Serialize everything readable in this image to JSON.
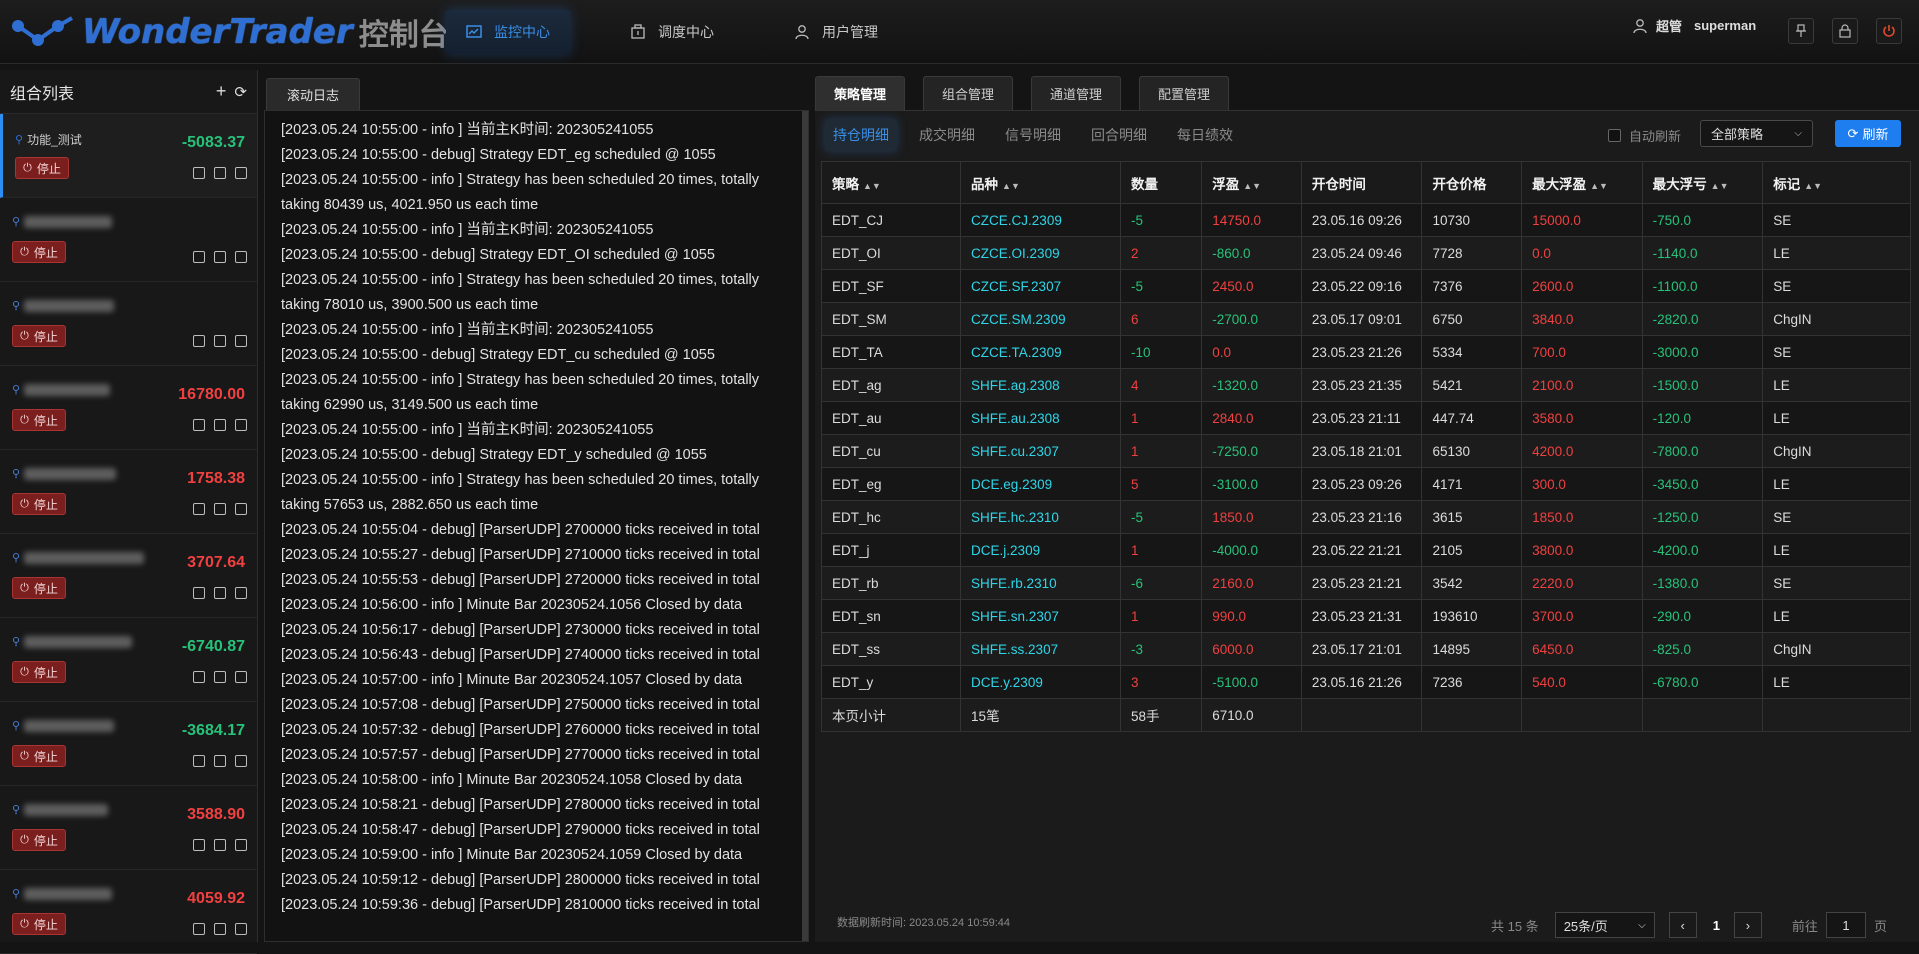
{
  "header": {
    "logo_text": "WonderTrader",
    "logo_sub": "控制台",
    "nav": [
      {
        "label": "监控中心",
        "icon": "monitor-icon"
      },
      {
        "label": "调度中心",
        "icon": "schedule-icon"
      },
      {
        "label": "用户管理",
        "icon": "user-icon"
      }
    ],
    "user_role": "超管",
    "user_name": "superman"
  },
  "left": {
    "title": "组合列表",
    "stop_label": "停止",
    "groups": [
      {
        "name": "功能_测试",
        "value": "-5083.37",
        "color": "green"
      },
      {
        "name": "",
        "value": "",
        "color": "green"
      },
      {
        "name": "",
        "value": "",
        "color": "green"
      },
      {
        "name": "",
        "value": "16780.00",
        "color": "red"
      },
      {
        "name": "",
        "value": "1758.38",
        "color": "red"
      },
      {
        "name": "",
        "value": "3707.64",
        "color": "red"
      },
      {
        "name": "",
        "value": "-6740.87",
        "color": "green"
      },
      {
        "name": "",
        "value": "-3684.17",
        "color": "green"
      },
      {
        "name": "",
        "value": "3588.90",
        "color": "red"
      },
      {
        "name": "",
        "value": "4059.92",
        "color": "red"
      }
    ]
  },
  "log": {
    "tab": "滚动日志",
    "lines": [
      "[2023.05.24 10:55:00 - info ] 当前主K时间: 202305241055",
      "[2023.05.24 10:55:00 - debug] Strategy EDT_eg scheduled @ 1055",
      "[2023.05.24 10:55:00 - info ] Strategy has been scheduled 20 times, totally",
      "taking 80439 us, 4021.950 us each time",
      "[2023.05.24 10:55:00 - info ] 当前主K时间: 202305241055",
      "[2023.05.24 10:55:00 - debug] Strategy EDT_OI scheduled @ 1055",
      "[2023.05.24 10:55:00 - info ] Strategy has been scheduled 20 times, totally",
      "taking 78010 us, 3900.500 us each time",
      "[2023.05.24 10:55:00 - info ] 当前主K时间: 202305241055",
      "[2023.05.24 10:55:00 - debug] Strategy EDT_cu scheduled @ 1055",
      "[2023.05.24 10:55:00 - info ] Strategy has been scheduled 20 times, totally",
      "taking 62990 us, 3149.500 us each time",
      "[2023.05.24 10:55:00 - info ] 当前主K时间: 202305241055",
      "[2023.05.24 10:55:00 - debug] Strategy EDT_y scheduled @ 1055",
      "[2023.05.24 10:55:00 - info ] Strategy has been scheduled 20 times, totally",
      "taking 57653 us, 2882.650 us each time",
      "[2023.05.24 10:55:04 - debug] [ParserUDP] 2700000 ticks received in total",
      "[2023.05.24 10:55:27 - debug] [ParserUDP] 2710000 ticks received in total",
      "[2023.05.24 10:55:53 - debug] [ParserUDP] 2720000 ticks received in total",
      "[2023.05.24 10:56:00 - info ] Minute Bar 20230524.1056 Closed by data",
      "[2023.05.24 10:56:17 - debug] [ParserUDP] 2730000 ticks received in total",
      "[2023.05.24 10:56:43 - debug] [ParserUDP] 2740000 ticks received in total",
      "[2023.05.24 10:57:00 - info ] Minute Bar 20230524.1057 Closed by data",
      "[2023.05.24 10:57:08 - debug] [ParserUDP] 2750000 ticks received in total",
      "[2023.05.24 10:57:32 - debug] [ParserUDP] 2760000 ticks received in total",
      "[2023.05.24 10:57:57 - debug] [ParserUDP] 2770000 ticks received in total",
      "[2023.05.24 10:58:00 - info ] Minute Bar 20230524.1058 Closed by data",
      "[2023.05.24 10:58:21 - debug] [ParserUDP] 2780000 ticks received in total",
      "[2023.05.24 10:58:47 - debug] [ParserUDP] 2790000 ticks received in total",
      "[2023.05.24 10:59:00 - info ] Minute Bar 20230524.1059 Closed by data",
      "[2023.05.24 10:59:12 - debug] [ParserUDP] 2800000 ticks received in total",
      "[2023.05.24 10:59:36 - debug] [ParserUDP] 2810000 ticks received in total"
    ]
  },
  "right": {
    "tabs": [
      "策略管理",
      "组合管理",
      "通道管理",
      "配置管理"
    ],
    "subtabs": [
      "持仓明细",
      "成交明细",
      "信号明细",
      "回合明细",
      "每日绩效"
    ],
    "auto_refresh": "自动刷新",
    "strategy_select": "全部策略",
    "refresh_btn": "刷新",
    "columns": [
      "策略",
      "品种",
      "数量",
      "浮盈",
      "开仓时间",
      "开仓价格",
      "最大浮盈",
      "最大浮亏",
      "标记"
    ],
    "rows": [
      [
        "EDT_CJ",
        "CZCE.CJ.2309",
        "-5",
        "14750.0",
        "23.05.16 09:26",
        "10730",
        "15000.0",
        "-750.0",
        "SE"
      ],
      [
        "EDT_OI",
        "CZCE.OI.2309",
        "2",
        "-860.0",
        "23.05.24 09:46",
        "7728",
        "0.0",
        "-1140.0",
        "LE"
      ],
      [
        "EDT_SF",
        "CZCE.SF.2307",
        "-5",
        "2450.0",
        "23.05.22 09:16",
        "7376",
        "2600.0",
        "-1100.0",
        "SE"
      ],
      [
        "EDT_SM",
        "CZCE.SM.2309",
        "6",
        "-2700.0",
        "23.05.17 09:01",
        "6750",
        "3840.0",
        "-2820.0",
        "ChgIN"
      ],
      [
        "EDT_TA",
        "CZCE.TA.2309",
        "-10",
        "0.0",
        "23.05.23 21:26",
        "5334",
        "700.0",
        "-3000.0",
        "SE"
      ],
      [
        "EDT_ag",
        "SHFE.ag.2308",
        "4",
        "-1320.0",
        "23.05.23 21:35",
        "5421",
        "2100.0",
        "-1500.0",
        "LE"
      ],
      [
        "EDT_au",
        "SHFE.au.2308",
        "1",
        "2840.0",
        "23.05.23 21:11",
        "447.74",
        "3580.0",
        "-120.0",
        "LE"
      ],
      [
        "EDT_cu",
        "SHFE.cu.2307",
        "1",
        "-7250.0",
        "23.05.18 21:01",
        "65130",
        "4200.0",
        "-7800.0",
        "ChgIN"
      ],
      [
        "EDT_eg",
        "DCE.eg.2309",
        "5",
        "-3100.0",
        "23.05.23 09:26",
        "4171",
        "300.0",
        "-3450.0",
        "LE"
      ],
      [
        "EDT_hc",
        "SHFE.hc.2310",
        "-5",
        "1850.0",
        "23.05.23 21:16",
        "3615",
        "1850.0",
        "-1250.0",
        "SE"
      ],
      [
        "EDT_j",
        "DCE.j.2309",
        "1",
        "-4000.0",
        "23.05.22 21:21",
        "2105",
        "3800.0",
        "-4200.0",
        "LE"
      ],
      [
        "EDT_rb",
        "SHFE.rb.2310",
        "-6",
        "2160.0",
        "23.05.23 21:21",
        "3542",
        "2220.0",
        "-1380.0",
        "SE"
      ],
      [
        "EDT_sn",
        "SHFE.sn.2307",
        "1",
        "990.0",
        "23.05.23 21:31",
        "193610",
        "3700.0",
        "-290.0",
        "LE"
      ],
      [
        "EDT_ss",
        "SHFE.ss.2307",
        "-3",
        "6000.0",
        "23.05.17 21:01",
        "14895",
        "6450.0",
        "-825.0",
        "ChgIN"
      ],
      [
        "EDT_y",
        "DCE.y.2309",
        "3",
        "-5100.0",
        "23.05.16 21:26",
        "7236",
        "540.0",
        "-6780.0",
        "LE"
      ]
    ],
    "subtotal": [
      "本页小计",
      "15笔",
      "58手",
      "6710.0"
    ],
    "update_time": "数据刷新时间: 2023.05.24 10:59:44",
    "total": "共 15 条",
    "page_size": "25条/页",
    "current_page": "1",
    "goto_label": "前往",
    "goto_value": "1",
    "page_unit": "页"
  },
  "colors": {
    "red": "#f04040",
    "green": "#27c27a",
    "cyan": "#2ed6e8",
    "accent": "#1e7ef0"
  }
}
